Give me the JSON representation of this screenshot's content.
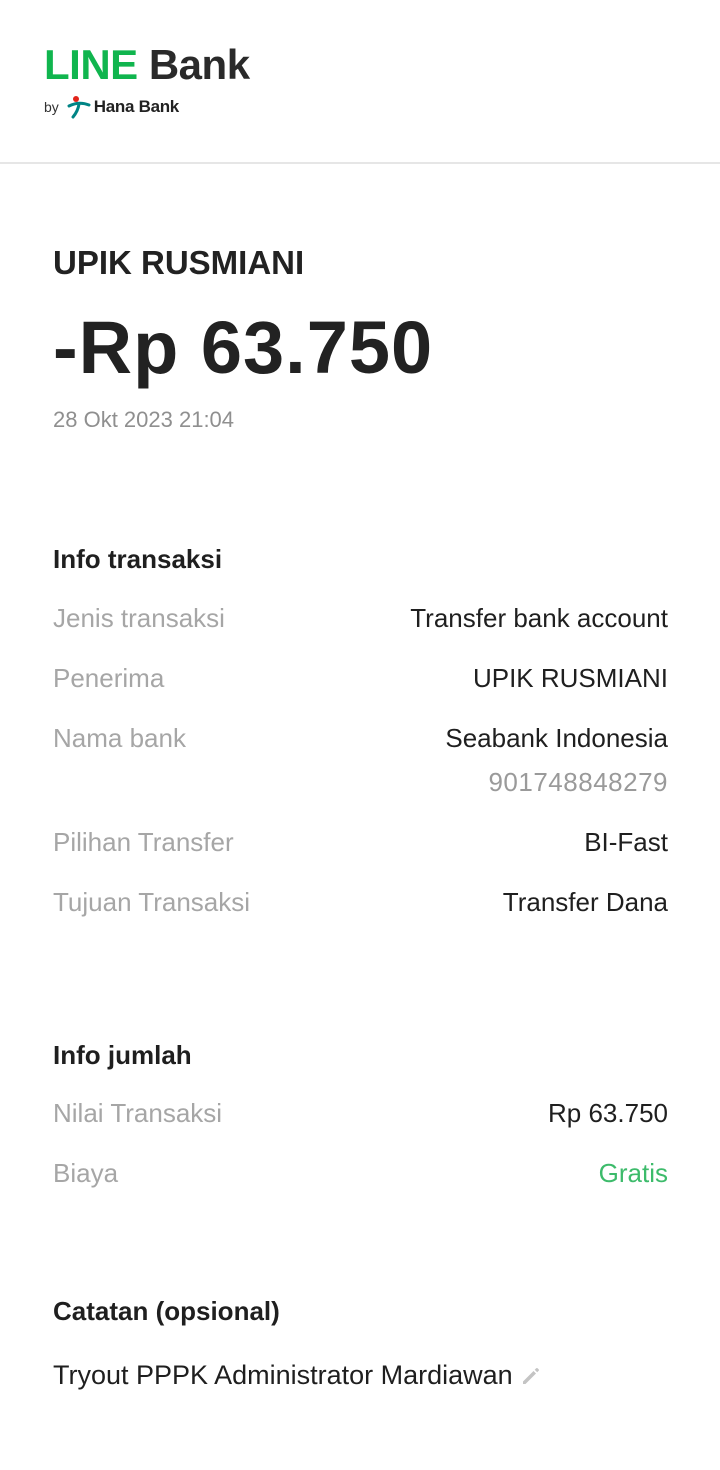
{
  "brand": {
    "line": "LINE",
    "bank": "Bank",
    "by": "by",
    "partner": "Hana Bank"
  },
  "summary": {
    "recipient": "UPIK RUSMIANI",
    "amount": "-Rp 63.750",
    "datetime": "28 Okt 2023 21:04"
  },
  "transaction_info": {
    "title": "Info transaksi",
    "rows": [
      {
        "label": "Jenis transaksi",
        "value": "Transfer bank account"
      },
      {
        "label": "Penerima",
        "value": "UPIK RUSMIANI"
      },
      {
        "label": "Nama bank",
        "value": "Seabank Indonesia",
        "subvalue": "901748848279"
      },
      {
        "label": "Pilihan Transfer",
        "value": "BI-Fast"
      },
      {
        "label": "Tujuan Transaksi",
        "value": "Transfer Dana"
      }
    ]
  },
  "amount_info": {
    "title": "Info jumlah",
    "rows": [
      {
        "label": "Nilai Transaksi",
        "value": "Rp 63.750"
      },
      {
        "label": "Biaya",
        "value": "Gratis"
      }
    ]
  },
  "note": {
    "title": "Catatan (opsional)",
    "text": "Tryout PPPK Administrator Mardiawan",
    "edit_icon": "pencil-icon"
  },
  "colors": {
    "brand_green": "#10b54e",
    "free_green": "#3dbb6b",
    "label_gray": "#a6a6a6",
    "hana_teal": "#008485",
    "hana_red": "#e2231a"
  }
}
